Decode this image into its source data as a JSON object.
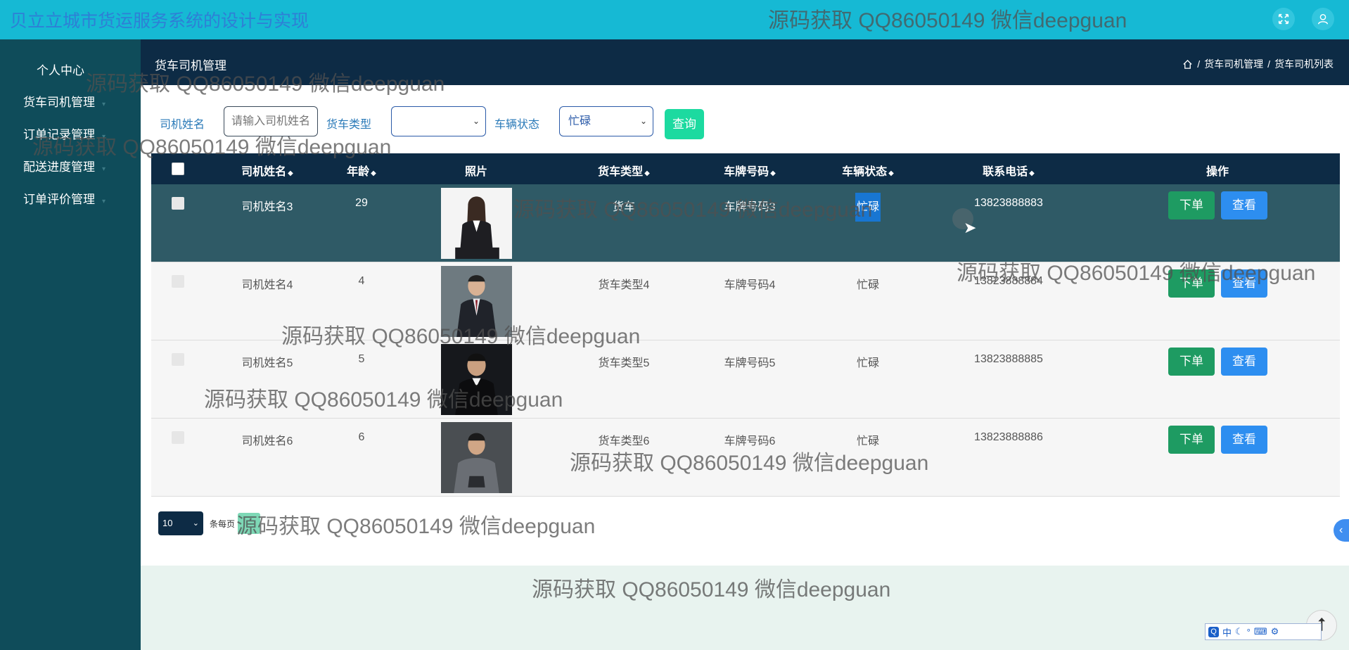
{
  "app": {
    "title": "贝立立城市货运服务系统的设计与实现"
  },
  "watermark": "源码获取 QQ86050149 微信deepguan",
  "topbar": {
    "fullscreen_icon": "expand-icon",
    "user_icon": "user-icon"
  },
  "sidebar": {
    "items": [
      {
        "label": "个人中心"
      },
      {
        "label": "货车司机管理"
      },
      {
        "label": "订单记录管理"
      },
      {
        "label": "配送进度管理"
      },
      {
        "label": "订单评价管理"
      }
    ]
  },
  "header": {
    "page_title": "货车司机管理",
    "breadcrumb": [
      "货车司机管理",
      "货车司机列表"
    ],
    "breadcrumb_sep": "/"
  },
  "search": {
    "name_label": "司机姓名",
    "name_placeholder": "请输入司机姓名",
    "type_label": "货车类型",
    "type_value": "",
    "status_label": "车辆状态",
    "status_value": "忙碌",
    "query_button": "查询"
  },
  "table": {
    "columns": [
      "司机姓名",
      "年龄",
      "照片",
      "货车类型",
      "车牌号码",
      "车辆状态",
      "联系电话",
      "操作"
    ],
    "sort_glyph": "◆",
    "rows": [
      {
        "name": "司机姓名3",
        "age": "29",
        "truck_type": "货车",
        "plate": "车牌号码3",
        "status": "忙碌",
        "phone": "13823888883"
      },
      {
        "name": "司机姓名4",
        "age": "4",
        "truck_type": "货车类型4",
        "plate": "车牌号码4",
        "status": "忙碌",
        "phone": "13823888884"
      },
      {
        "name": "司机姓名5",
        "age": "5",
        "truck_type": "货车类型5",
        "plate": "车牌号码5",
        "status": "忙碌",
        "phone": "13823888885"
      },
      {
        "name": "司机姓名6",
        "age": "6",
        "truck_type": "货车类型6",
        "plate": "车牌号码6",
        "status": "忙碌",
        "phone": "13823888886"
      }
    ],
    "order_button": "下单",
    "view_button": "查看"
  },
  "pager": {
    "page_size": "10",
    "page_size_label": "条每页"
  },
  "ime": {
    "logo": "Q",
    "mode": "中"
  },
  "colors": {
    "topbar": "#16b9d4",
    "sidebar": "#0f4c5a",
    "header": "#0d2b45",
    "selected_row": "#2f5a66",
    "order_button": "#1e9b62",
    "view_button": "#2d8ef0",
    "query_button": "#1cdaa0"
  }
}
